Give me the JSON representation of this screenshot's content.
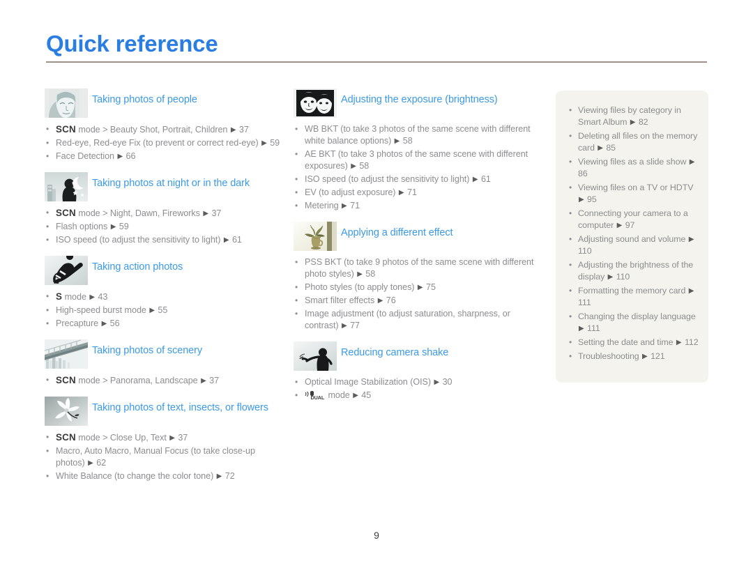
{
  "header": {
    "title": "Quick reference",
    "accent_color": "#2a7de1",
    "rule_color": "#9c9089"
  },
  "footer": {
    "page_number": "9"
  },
  "theme": {
    "heading_color": "#3b9ae8",
    "body_text_color": "#8b8d8e",
    "panel_bg": "#f4f3ee",
    "thumb_bg": "#e9eaea"
  },
  "columns": {
    "left": [
      {
        "icon": "portrait-face-icon",
        "title": "Taking photos of people",
        "items": [
          {
            "mode": "SCN",
            "text": " mode > Beauty Shot, Portrait, Children ",
            "page": "37"
          },
          {
            "mode": "",
            "text": "Red-eye, Red-eye Fix (to prevent or correct red-eye) ",
            "page": "59"
          },
          {
            "mode": "",
            "text": "Face Detection ",
            "page": "66"
          }
        ]
      },
      {
        "icon": "night-scene-icon",
        "title": "Taking photos at night or in the dark",
        "items": [
          {
            "mode": "SCN",
            "text": " mode > Night, Dawn, Fireworks ",
            "page": "37"
          },
          {
            "mode": "",
            "text": "Flash options ",
            "page": "59"
          },
          {
            "mode": "",
            "text": "ISO speed (to adjust the sensitivity to light) ",
            "page": "61"
          }
        ]
      },
      {
        "icon": "snowboarder-action-icon",
        "title": "Taking action photos",
        "items": [
          {
            "mode": "S",
            "text": " mode ",
            "page": "43"
          },
          {
            "mode": "",
            "text": "High-speed burst mode ",
            "page": "55"
          },
          {
            "mode": "",
            "text": "Precapture ",
            "page": "56"
          }
        ]
      },
      {
        "icon": "bridge-scenery-icon",
        "title": "Taking photos of scenery",
        "items": [
          {
            "mode": "SCN",
            "text": " mode > Panorama, Landscape ",
            "page": "37"
          }
        ]
      },
      {
        "icon": "flower-macro-icon",
        "title": "Taking photos of text, insects, or flowers",
        "items": [
          {
            "mode": "SCN",
            "text": " mode > Close Up, Text ",
            "page": "37"
          },
          {
            "mode": "",
            "text": "Macro, Auto Macro, Manual Focus (to take close-up photos) ",
            "page": "62"
          },
          {
            "mode": "",
            "text": "White Balance (to change the color tone) ",
            "page": "72"
          }
        ]
      }
    ],
    "middle": [
      {
        "icon": "two-faces-exposure-icon",
        "title": "Adjusting the exposure (brightness)",
        "items": [
          {
            "mode": "",
            "text": "WB BKT (to take 3 photos of the same scene with different white balance options) ",
            "page": "58"
          },
          {
            "mode": "",
            "text": "AE BKT (to take 3 photos of the same scene with different exposures) ",
            "page": "58"
          },
          {
            "mode": "",
            "text": "ISO speed (to adjust the sensitivity to light) ",
            "page": "61"
          },
          {
            "mode": "",
            "text": "EV (to adjust exposure) ",
            "page": "71"
          },
          {
            "mode": "",
            "text": "Metering ",
            "page": "71"
          }
        ]
      },
      {
        "icon": "vase-flowers-effect-icon",
        "title": "Applying a different effect",
        "items": [
          {
            "mode": "",
            "text": "PSS BKT (to take 9 photos of the same scene with different photo styles) ",
            "page": "58"
          },
          {
            "mode": "",
            "text": "Photo styles (to apply tones) ",
            "page": "75"
          },
          {
            "mode": "",
            "text": "Smart filter effects ",
            "page": "76"
          },
          {
            "mode": "",
            "text": "Image adjustment (to adjust saturation, sharpness, or contrast) ",
            "page": "77"
          }
        ]
      },
      {
        "icon": "camera-shake-person-icon",
        "title": "Reducing camera shake",
        "items": [
          {
            "mode": "",
            "text": "Optical Image Stabilization (OIS) ",
            "page": "30"
          },
          {
            "mode": "DUAL",
            "text": " mode ",
            "page": "45"
          }
        ]
      }
    ]
  },
  "side_panel": {
    "items": [
      {
        "text": "Viewing files by category in Smart Album ",
        "page": "82"
      },
      {
        "text": "Deleting all files on the memory card ",
        "page": "85"
      },
      {
        "text": "Viewing files as a slide show ",
        "page": "86"
      },
      {
        "text": "Viewing files on a TV or HDTV ",
        "page": "95"
      },
      {
        "text": "Connecting your camera to a computer ",
        "page": "97"
      },
      {
        "text": "Adjusting sound and volume ",
        "page": "110"
      },
      {
        "text": "Adjusting the brightness of the display ",
        "page": "110"
      },
      {
        "text": "Formatting the memory card ",
        "page": "111"
      },
      {
        "text": "Changing the display language ",
        "page": "111"
      },
      {
        "text": "Setting the date and time ",
        "page": "112"
      },
      {
        "text": "Troubleshooting ",
        "page": "121"
      }
    ]
  }
}
